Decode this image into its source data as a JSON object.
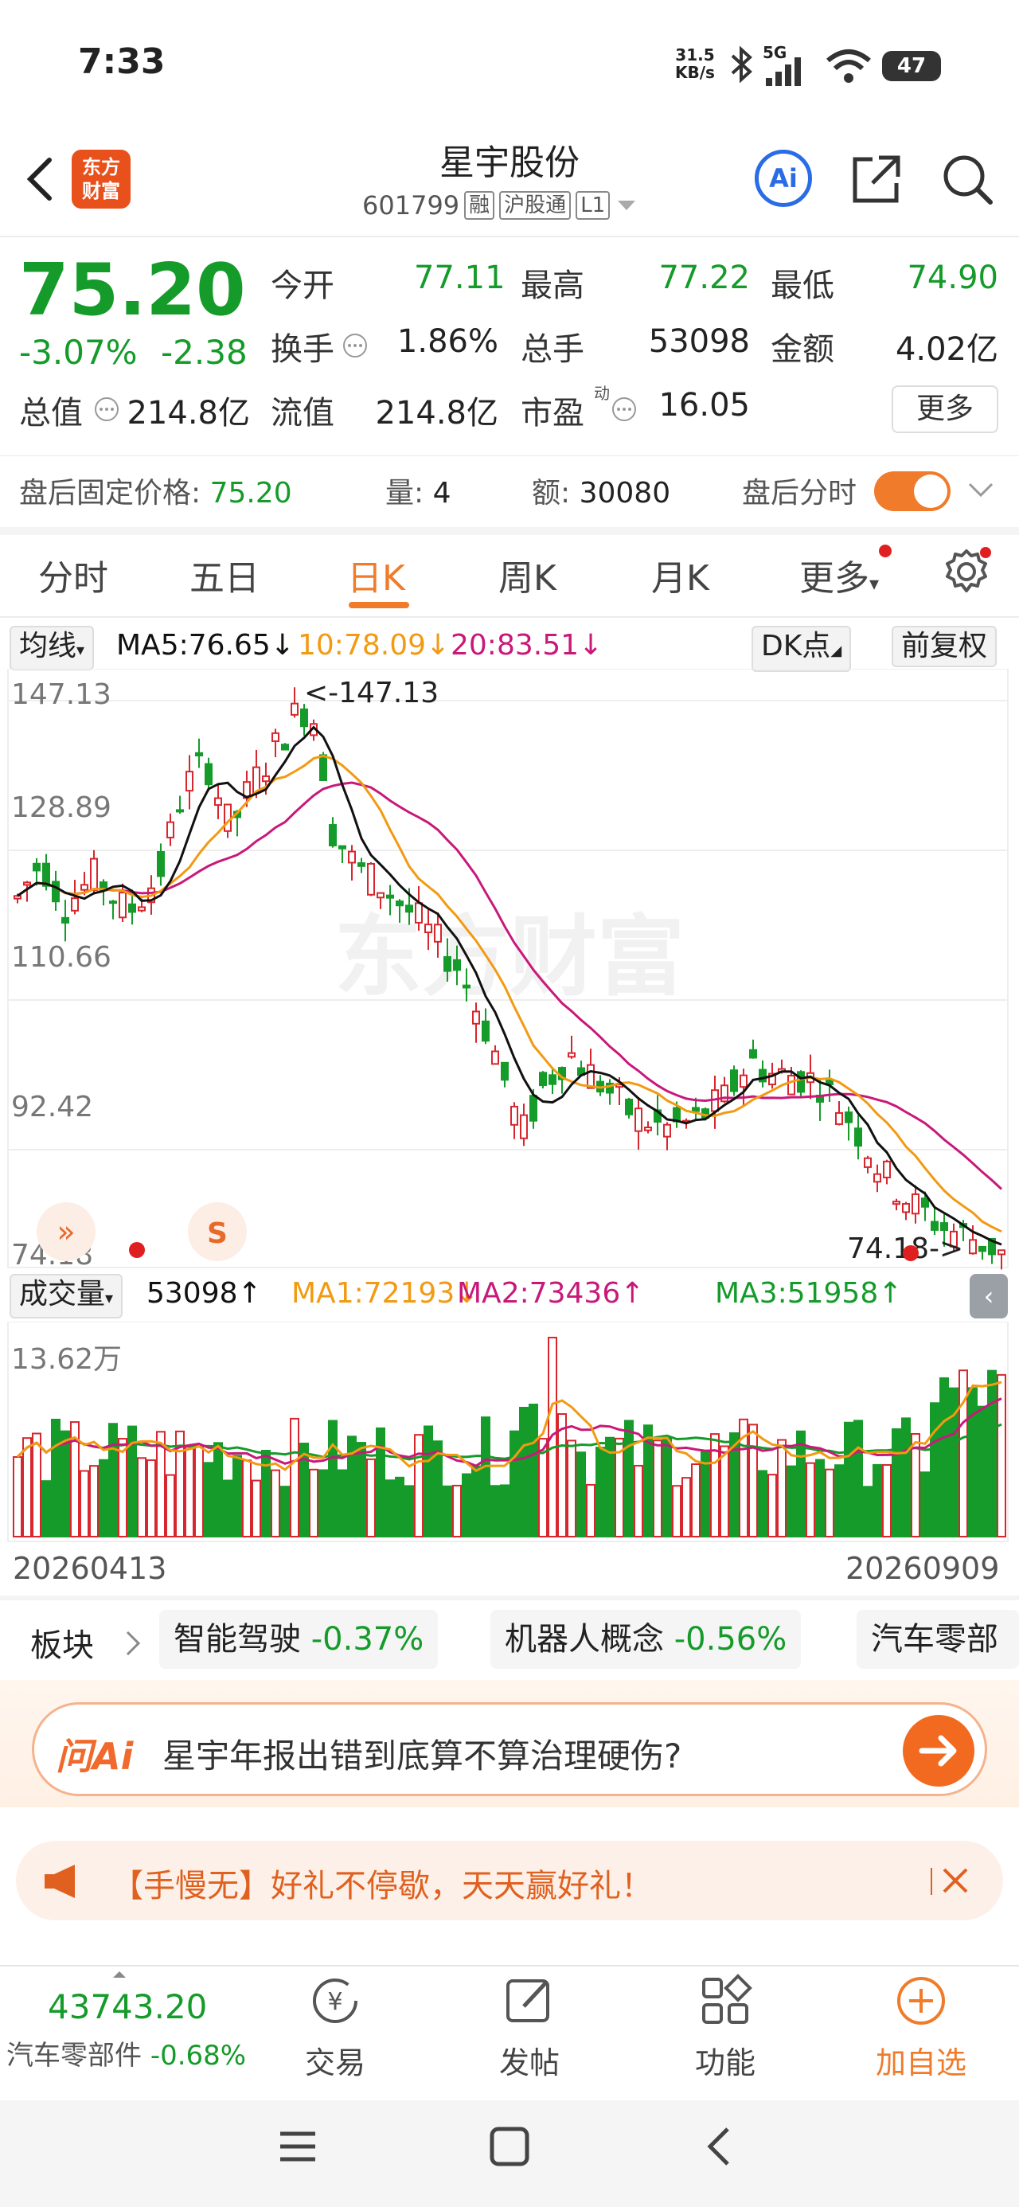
{
  "status": {
    "time": "7:33",
    "net_speed": "31.5",
    "net_unit": "KB/s",
    "signal": "5G",
    "battery": "47"
  },
  "header": {
    "logo": "东方财富",
    "title": "星宇股份",
    "code": "601799",
    "tags": [
      "融",
      "沪股通",
      "L1"
    ],
    "ai": "Ai"
  },
  "quote": {
    "price": "75.20",
    "change_pct": "-3.07%",
    "change_amt": "-2.38",
    "fields": [
      {
        "label": "今开",
        "value": "77.11",
        "color": "green"
      },
      {
        "label": "最高",
        "value": "77.22",
        "color": "green"
      },
      {
        "label": "最低",
        "value": "74.90",
        "color": "green"
      },
      {
        "label": "换手",
        "value": "1.86%",
        "color": "black"
      },
      {
        "label": "总手",
        "value": "53098",
        "color": "black"
      },
      {
        "label": "金额",
        "value": "4.02亿",
        "color": "black"
      },
      {
        "label": "总值",
        "value": "214.8亿",
        "color": "black"
      },
      {
        "label": "流值",
        "value": "214.8亿",
        "color": "black"
      },
      {
        "label": "市盈",
        "value": "16.05",
        "color": "black"
      }
    ],
    "pe_sup": "动",
    "more": "更多"
  },
  "after_hours": {
    "label": "盘后固定价格:",
    "price": "75.20",
    "vol_label": "量:",
    "vol": "4",
    "amt_label": "额:",
    "amt": "30080",
    "switch_label": "盘后分时"
  },
  "tabs": [
    "分时",
    "五日",
    "日K",
    "周K",
    "月K",
    "更多"
  ],
  "active_tab": "日K",
  "ma": {
    "selector": "均线",
    "ma5": "MA5:76.65↓",
    "ma10": "10:78.09↓",
    "ma20": "20:83.51↓",
    "dk": "DK点",
    "adjust": "前复权"
  },
  "price_axis": [
    "147.13",
    "128.89",
    "110.66",
    "92.42",
    "74.18"
  ],
  "markers": {
    "high": "<-147.13",
    "low": "74.18->"
  },
  "watermark": "东方财富",
  "volume": {
    "selector": "成交量",
    "current": "53098↑",
    "ma1": "MA1:72193↓",
    "ma2": "MA2:73436↑",
    "ma3": "MA3:51958↑",
    "axis_max": "13.62万"
  },
  "date_range": {
    "start": "20260413",
    "end": "20260909"
  },
  "sectors": {
    "label": "板块",
    "items": [
      {
        "name": "智能驾驶",
        "pct": "-0.37%"
      },
      {
        "name": "机器人概念",
        "pct": "-0.56%"
      },
      {
        "name": "汽车零部",
        "pct": ""
      }
    ]
  },
  "ai_banner": {
    "logo": "问Ai",
    "question": "星宇年报出错到底算不算治理硬伤?"
  },
  "promo": {
    "text": "【手慢无】好礼不停歇，天天赢好礼！"
  },
  "bottom": {
    "index_value": "43743.20",
    "index_name": "汽车零部件",
    "index_pct": "-0.68%",
    "items": [
      "交易",
      "发帖",
      "功能",
      "加自选"
    ]
  },
  "colors": {
    "up": "#d7262d",
    "down": "#159b2a",
    "accent": "#f07b2a",
    "ma5": "#111111",
    "ma10": "#f29a12",
    "ma20": "#c8197a"
  }
}
